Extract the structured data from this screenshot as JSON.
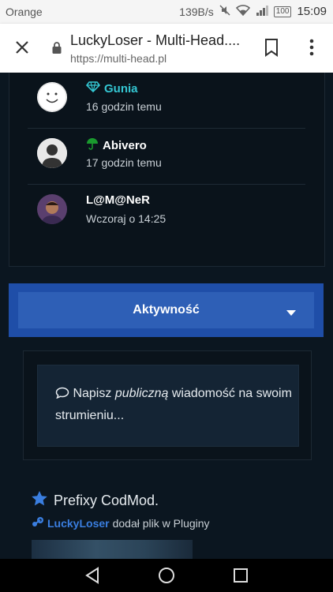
{
  "status_bar": {
    "carrier": "Orange",
    "speed": "139B/s",
    "battery": "100",
    "time": "15:09"
  },
  "browser": {
    "page_title": "LuckyLoser - Multi-Head....",
    "url": "https://multi-head.pl"
  },
  "online_users": [
    {
      "name": "Gunia",
      "time": "16 godzin temu",
      "badge": "diamond-icon",
      "name_color": "#34c6d2"
    },
    {
      "name": "Abivero",
      "time": "17 godzin temu",
      "badge": "umbrella-icon",
      "name_color": "#ffffff"
    },
    {
      "name": "L@M@NeR",
      "time": "Wczoraj o 14:25",
      "badge": "",
      "name_color": "#ffffff"
    }
  ],
  "activity": {
    "label": "Aktywność"
  },
  "status_update": {
    "prefix": "Napisz ",
    "emphasis": "publiczną",
    "suffix": " wiadomość na swoim strumieniu..."
  },
  "feed": {
    "title": "Prefixy CodMod.",
    "author": "LuckyLoser",
    "action": "dodał plik w Pluginy"
  },
  "colors": {
    "accent": "#2e5fb6",
    "link": "#3a7ee0",
    "background": "#0b1620"
  }
}
